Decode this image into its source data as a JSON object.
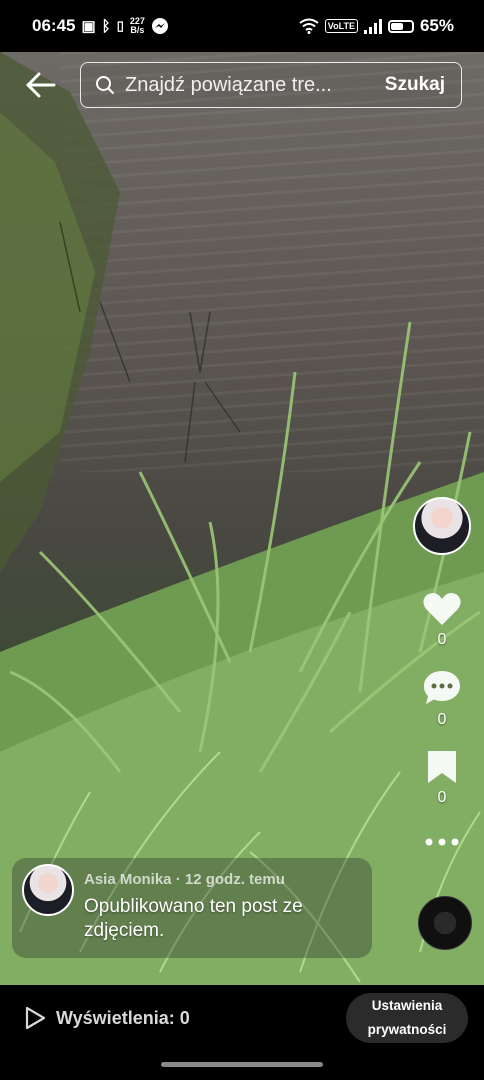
{
  "status_bar": {
    "time": "06:45",
    "net_speed_value": "227",
    "net_speed_unit": "B/s",
    "volte_label": "VoLTE",
    "battery_level": 65,
    "battery_text": "65%"
  },
  "search": {
    "placeholder": "Znajdź powiązane tre...",
    "button_label": "Szukaj"
  },
  "actions": {
    "like_count": "0",
    "comment_count": "0",
    "bookmark_count": "0"
  },
  "post": {
    "author": "Asia Monika",
    "time_ago": "12 godz. temu",
    "separator": " · ",
    "caption": "Opublikowano ten post ze zdjęciem."
  },
  "footer": {
    "views_label": "Wyświetlenia: 0",
    "privacy_line1": "Ustawienia",
    "privacy_line2": "prywatności"
  },
  "icons": [
    "back-arrow-icon",
    "search-icon",
    "heart-icon",
    "comment-icon",
    "bookmark-icon",
    "more-icon",
    "play-icon",
    "music-disc-icon"
  ]
}
